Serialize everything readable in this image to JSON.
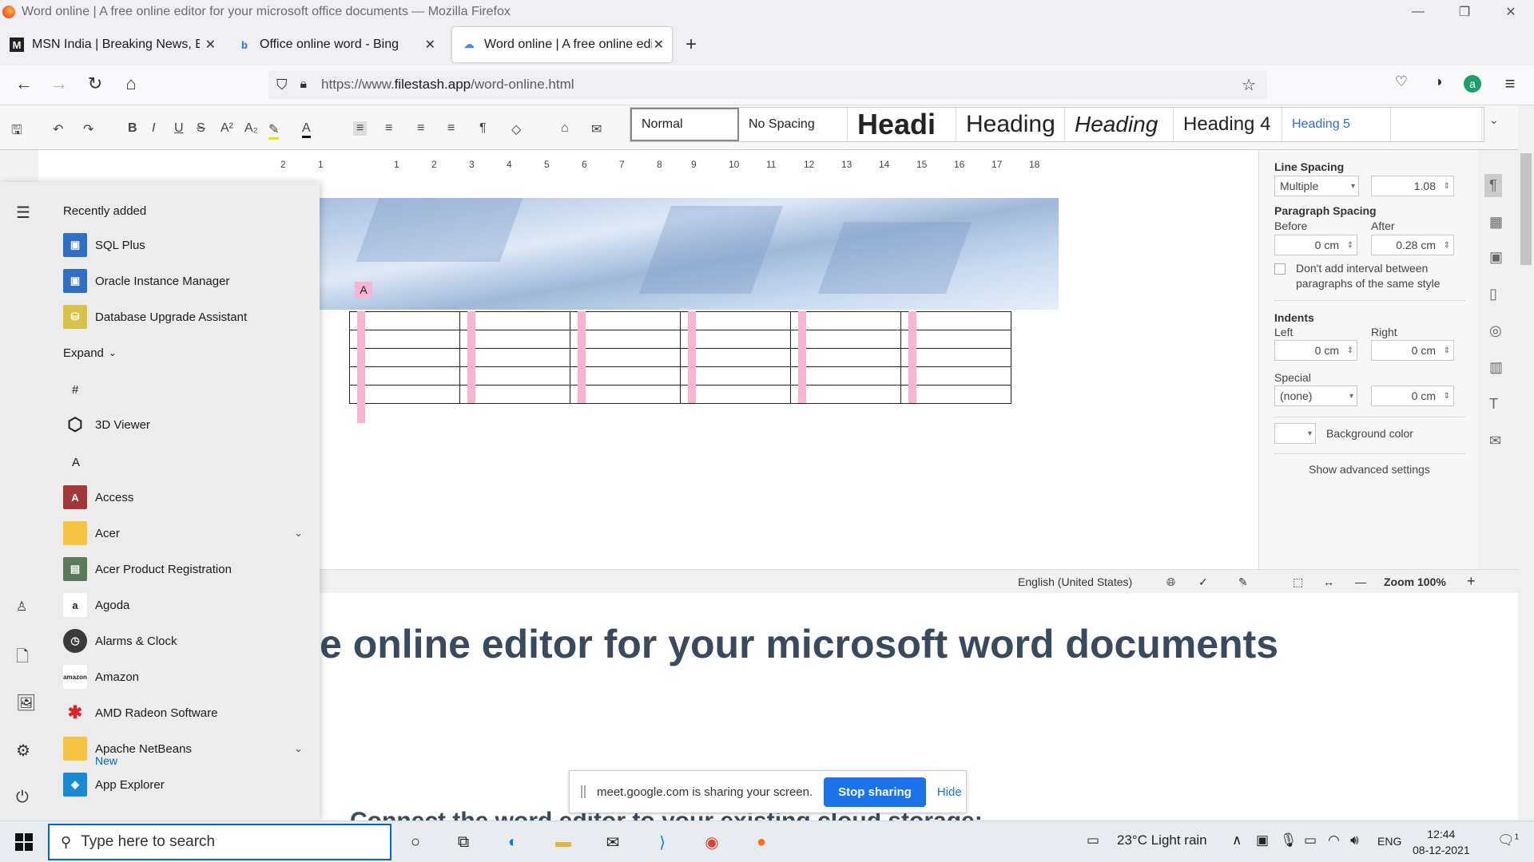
{
  "window": {
    "title": "Word online | A free online editor for your microsoft office documents — Mozilla Firefox"
  },
  "tabs": [
    {
      "label": "MSN India | Breaking News, Ente",
      "favicon": "msn-icon"
    },
    {
      "label": "Office online word - Bing",
      "favicon": "bing-icon"
    },
    {
      "label": "Word online | A free online edit",
      "favicon": "cloud-icon",
      "active": true
    }
  ],
  "nav": {
    "url_prefix": "https://www.",
    "url_domain": "filestash.app",
    "url_path": "/word-online.html"
  },
  "styles": [
    "Normal",
    "No Spacing",
    "Headi",
    "Heading",
    "Heading",
    "Heading 4",
    "Heading 5"
  ],
  "ruler": [
    "2",
    "1",
    "1",
    "2",
    "3",
    "4",
    "5",
    "6",
    "7",
    "8",
    "9",
    "10",
    "11",
    "12",
    "13",
    "14",
    "15",
    "16",
    "17",
    "18"
  ],
  "document": {
    "marker": "A",
    "table_rows": 5,
    "table_cols": 6
  },
  "status": {
    "language": "English (United States)",
    "zoom": "Zoom 100%"
  },
  "panel": {
    "line_spacing_title": "Line Spacing",
    "line_spacing_mode": "Multiple",
    "line_spacing_value": "1.08",
    "para_spacing_title": "Paragraph Spacing",
    "before_label": "Before",
    "after_label": "After",
    "before_value": "0 cm",
    "after_value": "0.28 cm",
    "no_interval_label": "Don't add interval between",
    "no_interval_label2": "paragraphs of the same style",
    "indents_title": "Indents",
    "left_label": "Left",
    "right_label": "Right",
    "left_value": "0 cm",
    "right_value": "0 cm",
    "special_label": "Special",
    "special_mode": "(none)",
    "special_value": "0 cm",
    "bg_color_label": "Background color",
    "advanced_label": "Show advanced settings"
  },
  "page": {
    "heading": "e online editor for your microsoft word documents",
    "subheading": "Connect the word editor to your existing cloud storage:"
  },
  "share": {
    "message": "meet.google.com is sharing your screen.",
    "stop": "Stop sharing",
    "hide": "Hide"
  },
  "start_menu": {
    "recent_title": "Recently added",
    "recent": [
      "SQL Plus",
      "Oracle Instance Manager",
      "Database Upgrade Assistant"
    ],
    "expand": "Expand",
    "hash": "#",
    "letter_a": "A",
    "apps": [
      "3D Viewer",
      "Access",
      "Acer",
      "Acer Product Registration",
      "Agoda",
      "Alarms & Clock",
      "Amazon",
      "AMD Radeon Software",
      "Apache NetBeans",
      "App Explorer"
    ],
    "new_tag": "New"
  },
  "taskbar": {
    "search_placeholder": "Type here to search",
    "weather": "23°C  Light rain",
    "lang": "ENG",
    "time": "12:44",
    "date": "08-12-2021",
    "notif_count": "1"
  }
}
